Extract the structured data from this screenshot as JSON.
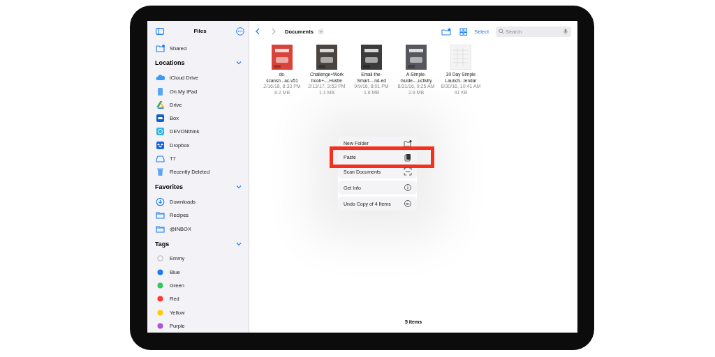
{
  "sidebar": {
    "title": "Files",
    "top_item": {
      "label": "Shared",
      "kind": "shared"
    },
    "sections": [
      {
        "title": "Locations",
        "expanded": true,
        "items": [
          {
            "label": "iCloud Drive",
            "kind": "cloud"
          },
          {
            "label": "On My iPad",
            "kind": "ipad"
          },
          {
            "label": "Drive",
            "kind": "drive"
          },
          {
            "label": "Box",
            "kind": "box"
          },
          {
            "label": "DEVONthink",
            "kind": "devonthink"
          },
          {
            "label": "Dropbox",
            "kind": "dropbox"
          },
          {
            "label": "T7",
            "kind": "disk"
          },
          {
            "label": "Recently Deleted",
            "kind": "trash"
          }
        ]
      },
      {
        "title": "Favorites",
        "expanded": true,
        "items": [
          {
            "label": "Downloads",
            "kind": "download"
          },
          {
            "label": "Recipes",
            "kind": "folder"
          },
          {
            "label": "@INBOX",
            "kind": "folder"
          }
        ]
      },
      {
        "title": "Tags",
        "expanded": true,
        "items": [
          {
            "label": "Emmy",
            "kind": "tag"
          },
          {
            "label": "Blue",
            "kind": "tag",
            "color": "#1a7cf5"
          },
          {
            "label": "Green",
            "kind": "tag",
            "color": "#34c759"
          },
          {
            "label": "Red",
            "kind": "tag",
            "color": "#ff3b30"
          },
          {
            "label": "Yellow",
            "kind": "tag",
            "color": "#ffcc00"
          },
          {
            "label": "Purple",
            "kind": "tag",
            "color": "#af52de"
          }
        ]
      }
    ]
  },
  "toolbar": {
    "folder": "Documents",
    "select": "Select",
    "search": {
      "placeholder": "Search"
    }
  },
  "files": [
    {
      "name": [
        "ds-",
        "scansn...ac-v51"
      ],
      "date": "2/16/18, 8:33 PM",
      "size": "8.2 MB"
    },
    {
      "name": [
        "Challenge+Work",
        "book+-...Hustle"
      ],
      "date": "2/13/17, 3:53 PM",
      "size": "1.1 MB"
    },
    {
      "name": [
        "Email-the-",
        "Smart-...nd-ed"
      ],
      "date": "9/9/16, 8:01 PM",
      "size": "1.6 MB"
    },
    {
      "name": [
        "A-Simple-",
        "Guide-...uctivity"
      ],
      "date": "8/31/16, 9:25 AM",
      "size": "2.9 MB"
    },
    {
      "name": [
        "30 Day Simple",
        "Launch...lendar"
      ],
      "date": "8/30/16, 10:41 AM",
      "size": "41 KB"
    }
  ],
  "footer": "5 items",
  "context_menu": [
    [
      {
        "label": "New Folder",
        "kind": "new-folder",
        "highlighted": false
      },
      {
        "label": "Paste",
        "kind": "paste",
        "highlighted": true
      },
      {
        "label": "Scan Documents",
        "kind": "scan",
        "highlighted": false
      }
    ],
    [
      {
        "label": "Get Info",
        "kind": "info",
        "highlighted": false
      }
    ],
    [
      {
        "label": "Undo Copy of 4 Items",
        "kind": "undo",
        "highlighted": false
      }
    ]
  ]
}
